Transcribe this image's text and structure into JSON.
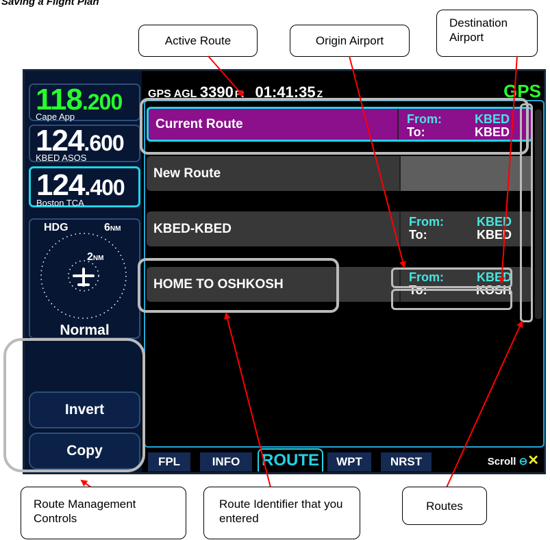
{
  "doc_title": "Saving a Flight Plan",
  "callouts": {
    "active_route": "Active Route",
    "origin_airport": "Origin Airport",
    "destination_airport": "Destination Airport",
    "route_mgmt": "Route Management Controls",
    "route_identifier": "Route Identifier that you entered",
    "routes": "Routes"
  },
  "radios": [
    {
      "main": "118",
      "dec": ".200",
      "label": "Cape App"
    },
    {
      "main": "124",
      "dec": ".600",
      "label": "KBED ASOS"
    },
    {
      "main": "124",
      "dec": ".400",
      "label": "Boston TCA"
    }
  ],
  "hsi": {
    "heading_label": "HDG",
    "range_outer": "6",
    "range_inner": "2",
    "range_unit": "NM",
    "mode": "Normal"
  },
  "softkeys": {
    "invert": "Invert",
    "copy": "Copy"
  },
  "status": {
    "gps_agl": "GPS AGL",
    "altitude": "3390",
    "alt_unit": "Ft",
    "time": "01:41:35",
    "time_zone": "Z",
    "nav_source": "GPS"
  },
  "routes": [
    {
      "name": "Current Route",
      "from_label": "From:",
      "from": "KBED",
      "to_label": "To:",
      "to": "KBED",
      "active": true
    },
    {
      "name": "New Route",
      "from_label": "",
      "from": "",
      "to_label": "",
      "to": "",
      "active": false
    },
    {
      "name": "KBED-KBED",
      "from_label": "From:",
      "from": "KBED",
      "to_label": "To:",
      "to": "KBED",
      "active": false
    },
    {
      "name": "HOME TO OSHKOSH",
      "from_label": "From:",
      "from": "KBED",
      "to_label": "To:",
      "to": "KOSH",
      "active": false
    }
  ],
  "tabs": [
    "FPL",
    "INFO",
    "ROUTE",
    "WPT",
    "NRST"
  ],
  "active_tab": "ROUTE",
  "scroll_hint": {
    "label": "Scroll",
    "knob_icon": "knob-icon",
    "clear_icon": "close-icon"
  },
  "colors": {
    "accent_cyan": "#22d3e6",
    "active_green": "#27ff2c",
    "active_route": "#8c0f8c",
    "annotation_red": "#ff0000"
  }
}
